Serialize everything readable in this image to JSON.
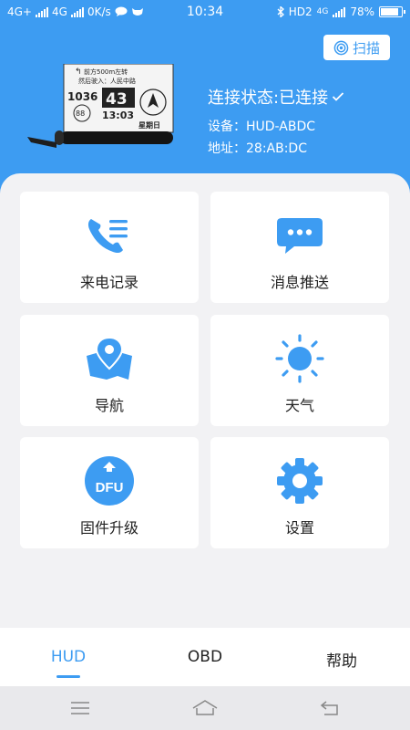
{
  "statusbar": {
    "net1": "4G+",
    "net2": "4G",
    "speed": "0K/s",
    "time": "10:34",
    "hd": "HD2",
    "net3": "4G",
    "battery": "78%",
    "battery_level": 0.78
  },
  "header": {
    "scan_label": "扫描",
    "connection_status": "连接状态:已连接",
    "device_line": "设备：HUD-ABDC",
    "address_line": "地址：28:AB:DC"
  },
  "hud_preview": {
    "speed": "43",
    "clock": "13:03",
    "nav_text_1": "前方500m左转",
    "nav_text_2": "然后驶入：人民中路",
    "weekday": "星期日",
    "left_time": "1036",
    "distance": "88"
  },
  "menu": [
    {
      "label": "来电记录",
      "icon": "phone-list-icon"
    },
    {
      "label": "消息推送",
      "icon": "chat-bubble-icon"
    },
    {
      "label": "导航",
      "icon": "map-pin-icon"
    },
    {
      "label": "天气",
      "icon": "sun-icon"
    },
    {
      "label": "固件升级",
      "icon": "dfu-upgrade-icon",
      "badge": "DFU"
    },
    {
      "label": "设置",
      "icon": "gear-icon"
    }
  ],
  "tabs": [
    {
      "label": "HUD",
      "active": true
    },
    {
      "label": "OBD",
      "active": false
    },
    {
      "label": "帮助",
      "active": false
    }
  ],
  "colors": {
    "accent": "#3d9cf2",
    "background": "#f2f2f4"
  }
}
